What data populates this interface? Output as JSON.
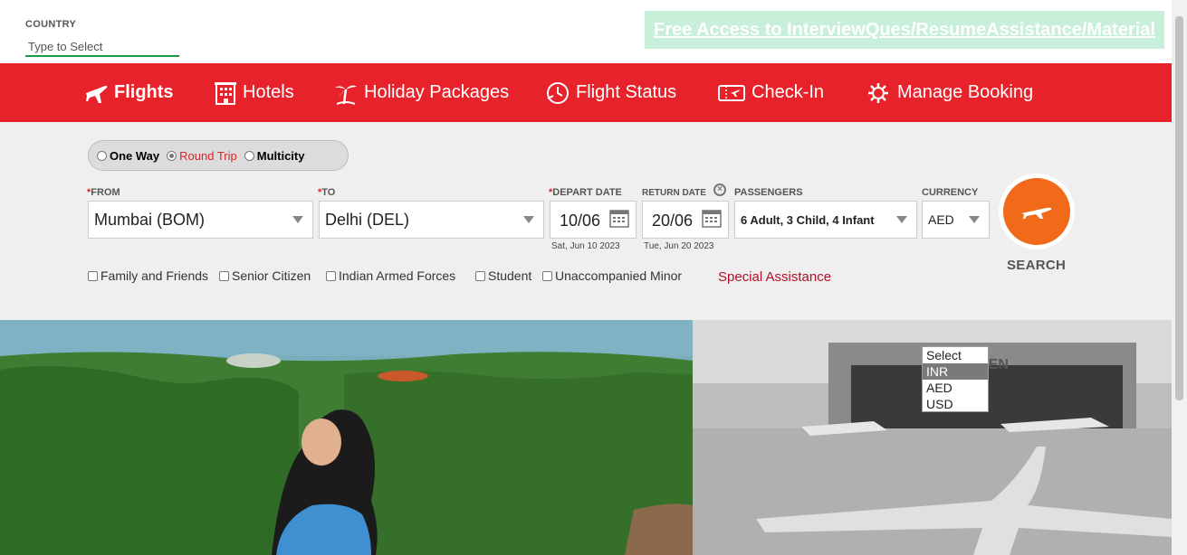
{
  "country": {
    "label": "COUNTRY",
    "placeholder": "Type to Select"
  },
  "promo": {
    "text": "Free Access to InterviewQues/ResumeAssistance/Material"
  },
  "nav": {
    "items": [
      {
        "label": "Flights",
        "icon": "airplane-icon"
      },
      {
        "label": "Hotels",
        "icon": "hotel-icon"
      },
      {
        "label": "Holiday Packages",
        "icon": "palm-tree-icon"
      },
      {
        "label": "Flight Status",
        "icon": "clock-icon"
      },
      {
        "label": "Check-In",
        "icon": "ticket-icon"
      },
      {
        "label": "Manage Booking",
        "icon": "gear-icon"
      }
    ]
  },
  "trip": {
    "one_way": "One Way",
    "round_trip": "Round Trip",
    "multicity": "Multicity",
    "selected": "Round Trip"
  },
  "form": {
    "from_label": "FROM",
    "from_value": "Mumbai (BOM)",
    "to_label": "TO",
    "to_value": "Delhi (DEL)",
    "depart_label": "DEPART DATE",
    "depart_value": "10/06",
    "depart_sub": "Sat, Jun 10 2023",
    "return_label": "RETURN DATE",
    "return_value": "20/06",
    "return_sub": "Tue, Jun 20 2023",
    "passengers_label": "PASSENGERS",
    "passengers_value": "6 Adult, 3 Child, 4 Infant",
    "currency_label": "CURRENCY",
    "currency_value": "AED",
    "required_mark": "*"
  },
  "options": {
    "family": "Family and Friends",
    "senior": "Senior Citizen",
    "armed": "Indian Armed Forces",
    "student": "Student",
    "minor": "Unaccompanied Minor",
    "special": "Special Assistance"
  },
  "search": {
    "label": "SEARCH"
  },
  "currency_dropdown": {
    "options": [
      "Select",
      "INR",
      "AED",
      "USD"
    ],
    "highlighted": "INR"
  },
  "colors": {
    "brand_red": "#e8222a",
    "search_orange": "#f06a1a",
    "accent_green": "#1a9a4a"
  }
}
